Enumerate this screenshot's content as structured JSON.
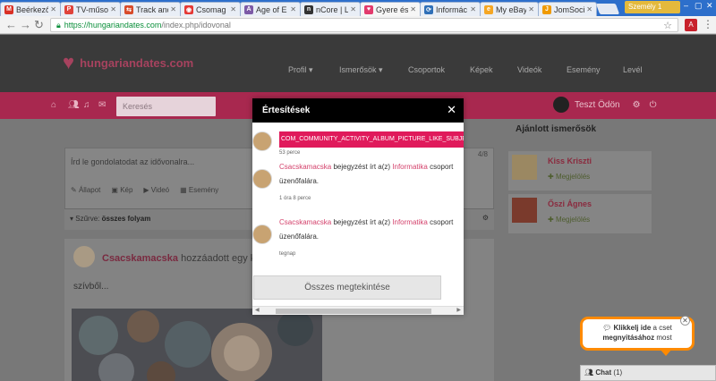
{
  "browser": {
    "tabs": [
      {
        "label": "Beérkező",
        "fav_color": "#d93025",
        "fav_text": "M"
      },
      {
        "label": "TV-műsor",
        "fav_color": "#e0433a",
        "fav_text": "P"
      },
      {
        "label": "Track and",
        "fav_color": "#d84b2a",
        "fav_text": "⇆"
      },
      {
        "label": "Csomag",
        "fav_color": "#e53935",
        "fav_text": "◉"
      },
      {
        "label": "Age of E",
        "fav_color": "#7d5aa6",
        "fav_text": "A"
      },
      {
        "label": "nCore | Li",
        "fav_color": "#333333",
        "fav_text": "n"
      },
      {
        "label": "Gyere és",
        "fav_color": "#e23a6d",
        "fav_text": "♥"
      },
      {
        "label": "Informác",
        "fav_color": "#2f6fb7",
        "fav_text": "⟳"
      },
      {
        "label": "My eBay",
        "fav_color": "#f5a623",
        "fav_text": "e"
      },
      {
        "label": "JomSocia",
        "fav_color": "#f09a00",
        "fav_text": "J"
      }
    ],
    "active_tab_index": 6,
    "profile": "Személy 1",
    "url_host": "https://hungariandates.com",
    "url_path": "/index.php/idovonal"
  },
  "site": {
    "logo": "hungariandates.com",
    "nav": [
      "Profil ▾",
      "Ismerősök ▾",
      "Csoportok",
      "Képek",
      "Videók",
      "Esemény",
      "Levél"
    ],
    "search_placeholder": "Keresés",
    "user_name": "Teszt Ödön"
  },
  "main": {
    "post_placeholder": "Írd le gondolatodat az idővonalra...",
    "post_counter": "4/8",
    "post_tools": [
      "Állapot",
      "Kép",
      "Videó",
      "Esemény"
    ],
    "filter_label": "Szűrve:",
    "filter_value": "összes folyam",
    "feed_user": "Csacskamacska",
    "feed_action": "hozzáadott egy képet",
    "feed_text": "szívből..."
  },
  "sidebar": {
    "title": "Ajánlott ismerősök",
    "friends": [
      {
        "name": "Kiss Kriszti",
        "action": "Megjelölés"
      },
      {
        "name": "Őszi Ágnes",
        "action": "Megjelölés"
      }
    ]
  },
  "modal": {
    "title": "Értesítések",
    "notifications": [
      {
        "code": "COM_COMMUNITY_ACTIVITY_ALBUM_PICTURE_LIKE_SUBJECT",
        "time": "53 perce"
      },
      {
        "user": "Csacskamacska",
        "mid": " bejegyzést írt a(z) ",
        "group": "Informatika",
        "end": " csoport üzenőfalára.",
        "time": "1 óra 8 perce"
      },
      {
        "user": "Csacskamacska",
        "mid": " bejegyzést írt a(z) ",
        "group": "Informatika",
        "end": " csoport üzenőfalára.",
        "time": "tegnap"
      }
    ],
    "view_all": "Összes megtekintése"
  },
  "chat": {
    "bubble_bold": "Klikkelj ide",
    "bubble_rest1": " a cset",
    "bubble_bold2": "megnyitásához",
    "bubble_rest2": " most",
    "bar_label": "Chat",
    "bar_count": "(1)"
  }
}
